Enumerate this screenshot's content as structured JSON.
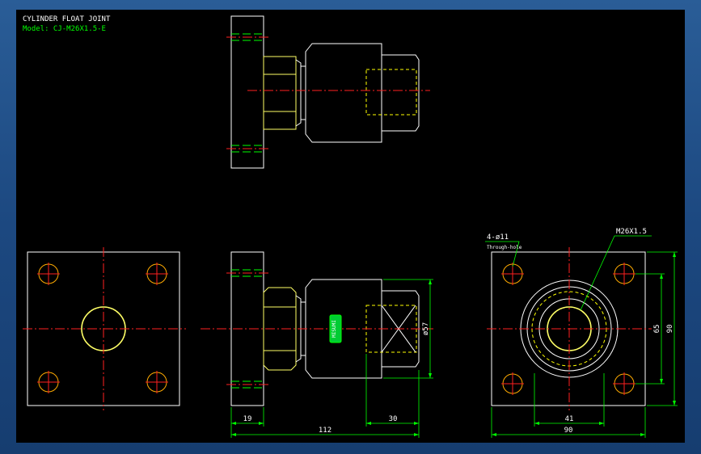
{
  "title_block": {
    "title": "CYLINDER FLOAT JOINT",
    "model": "Model: CJ-M26X1.5-E"
  },
  "annotations": {
    "holes_label": "4-ø11",
    "holes_note": "Through-hole",
    "thread_label": "M26X1.5"
  },
  "dimensions": {
    "d19": "19",
    "d112": "112",
    "d30": "30",
    "d57": "ø57",
    "d41": "41",
    "d90_h": "90",
    "d65": "65",
    "d90_v": "90"
  },
  "logo_text": "MISUMI",
  "colors": {
    "background": "#000000",
    "outline": "#ffffff",
    "centerline": "#ff2020",
    "dimension": "#00ff00",
    "hidden": "#ffff00",
    "hole": "#ffaa00"
  }
}
